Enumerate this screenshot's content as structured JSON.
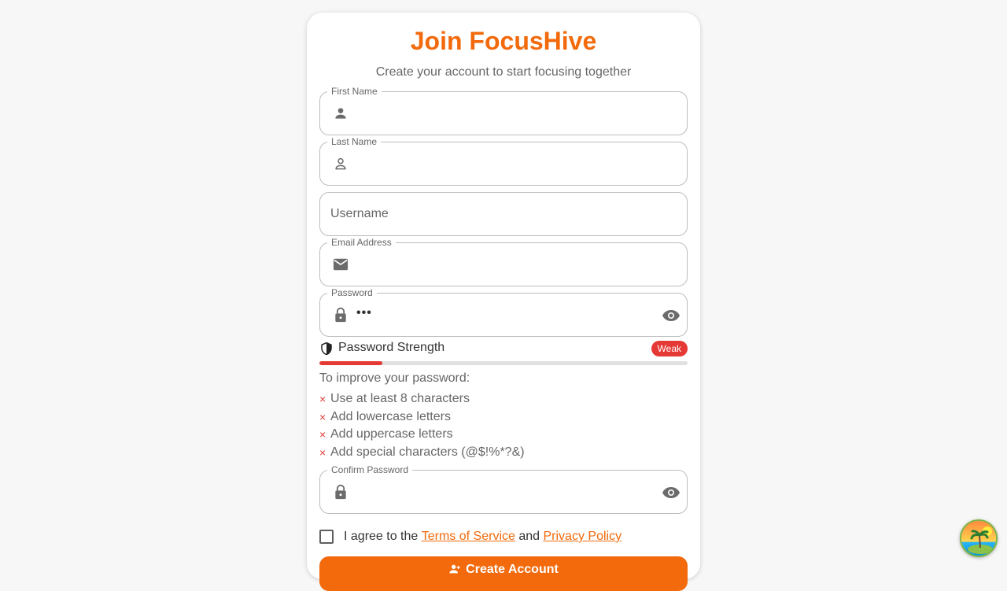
{
  "header": {
    "title": "Join FocusHive",
    "subtitle": "Create your account to start focusing together"
  },
  "fields": {
    "first_name": {
      "label": "First Name",
      "icon": "person-icon",
      "value": ""
    },
    "last_name": {
      "label": "Last Name",
      "icon": "person-outline-icon",
      "value": ""
    },
    "username": {
      "placeholder": "Username",
      "value": ""
    },
    "email": {
      "label": "Email Address",
      "icon": "mail-icon",
      "value": ""
    },
    "password": {
      "label": "Password",
      "icon": "lock-icon",
      "masked_value": "•••",
      "toggle_icon": "eye-icon"
    },
    "confirm_password": {
      "label": "Confirm Password",
      "icon": "lock-icon",
      "value": "",
      "toggle_icon": "eye-icon"
    }
  },
  "strength": {
    "title": "Password Strength",
    "badge": "Weak",
    "level_percent": 17,
    "icon": "shield-icon",
    "improve_title": "To improve your password:",
    "tip_marker": "×",
    "tips": [
      "Use at least 8 characters",
      "Add lowercase letters",
      "Add uppercase letters",
      "Add special characters (@$!%*?&)"
    ]
  },
  "agreement": {
    "prefix": "I agree to the",
    "terms_link": "Terms of Service",
    "conjunction": "and",
    "privacy_link": "Privacy Policy",
    "checked": false
  },
  "submit": {
    "label": "Create Account",
    "icon": "person-add-icon"
  },
  "colors": {
    "accent": "#f26a0c",
    "danger": "#e53935",
    "border": "#bdbdbd",
    "muted_text": "#666666"
  }
}
